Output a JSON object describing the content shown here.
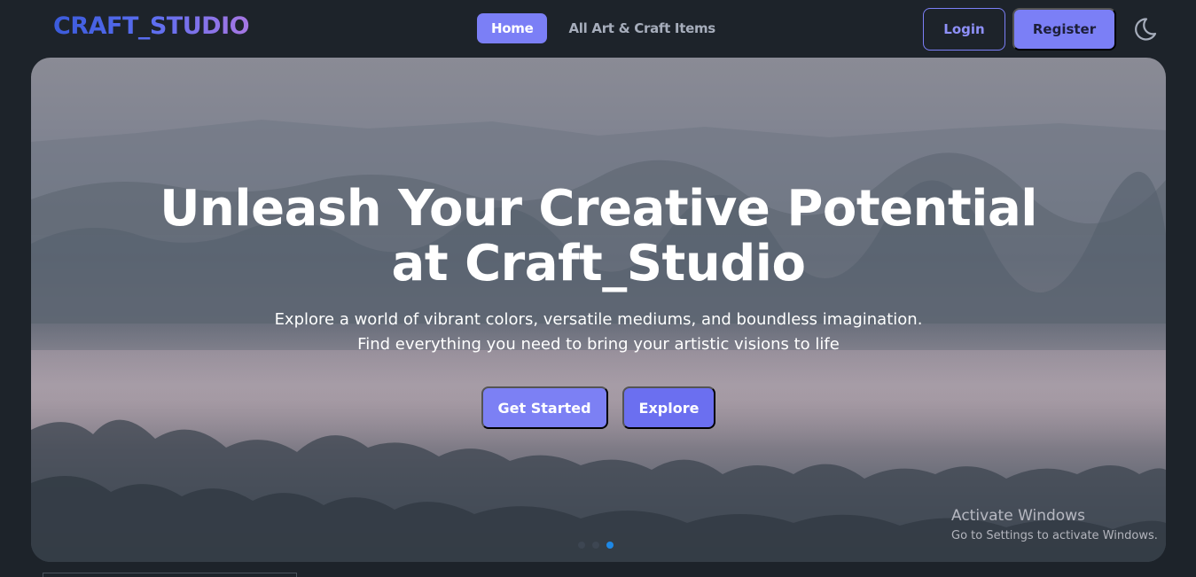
{
  "brand": {
    "logo": "CRAFT_STUDIO"
  },
  "nav": {
    "links": [
      {
        "label": "Home",
        "active": true
      },
      {
        "label": "All Art & Craft Items",
        "active": false
      }
    ],
    "login_label": "Login",
    "register_label": "Register",
    "theme_icon": "moon-icon"
  },
  "hero": {
    "title": "Unleash Your Creative Potential at Craft_Studio",
    "subtitle_line1": "Explore a world of vibrant colors, versatile mediums, and boundless imagination.",
    "subtitle_line2": "Find everything you need to bring your artistic visions to life",
    "primary_button": "Get Started",
    "secondary_button": "Explore",
    "slide_count": 3,
    "active_slide": 3
  },
  "watermark": {
    "title": "Activate Windows",
    "subtitle": "Go to Settings to activate Windows."
  },
  "colors": {
    "page_bg": "#1d232a",
    "accent": "#7b7ff6",
    "dot_active": "#1e88e5"
  }
}
